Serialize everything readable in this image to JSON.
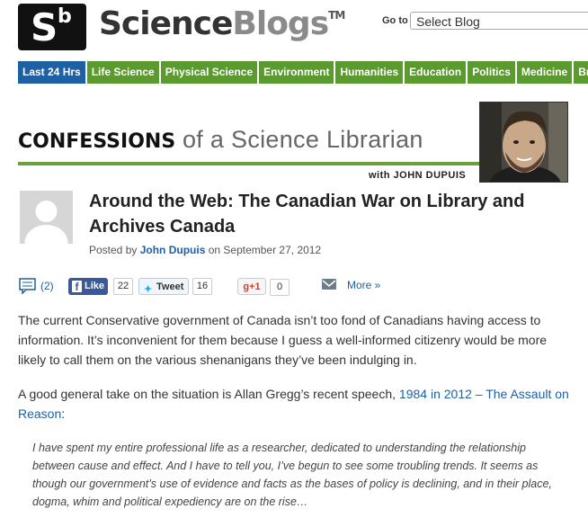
{
  "header": {
    "logo_letter": "S",
    "logo_superscript": "b",
    "brand_part1": "Science",
    "brand_part2": "Blogs",
    "brand_tm": "TM",
    "goto_label": "Go to",
    "goto_select_value": "Select Blog"
  },
  "nav": {
    "items": [
      {
        "label": "Last 24 Hrs",
        "active": true
      },
      {
        "label": "Life Science"
      },
      {
        "label": "Physical Science"
      },
      {
        "label": "Environment"
      },
      {
        "label": "Humanities"
      },
      {
        "label": "Education"
      },
      {
        "label": "Politics"
      },
      {
        "label": "Medicine"
      },
      {
        "label": "Bra"
      }
    ]
  },
  "blog": {
    "title_bold": "CONFESSIONS",
    "title_rest": " of a Science Librarian",
    "author_line": "with JOHN DUPUIS"
  },
  "post": {
    "title": "Around the Web: The Canadian War on Library and Archives Canada",
    "posted_by_label": "Posted by ",
    "author": "John Dupuis",
    "date_text": " on September 27, 2012"
  },
  "share": {
    "comments_count": "(2)",
    "fb_label": "Like",
    "fb_count": "22",
    "tweet_label": "Tweet",
    "tweet_count": "16",
    "gplus_label": "g+1",
    "gplus_count": "0",
    "more_label": "More »"
  },
  "body": {
    "para1": "The current Conservative government of Canada isn’t too fond of Canadians having access to information. It’s inconvenient for them because I guess a well-informed citizenry would be more likely to call them on the various shenanigans they’ve been indulging in.",
    "para2_text": "A good general take on the situation is Allan Gregg’s recent speech, ",
    "para2_link": "1984 in 2012 – The Assault on Reason",
    "para2_end": ":",
    "quote": "I have spent my entire professional life as a researcher, dedicated to understanding the relationship between cause and effect. And I have to tell you, I’ve begun to see some troubling trends. It seems as though our government’s use of evidence and facts as the bases of policy is declining, and in their place, dogma, whim and political expediency are on the rise…"
  },
  "colors": {
    "nav_green": "#5b9a2e",
    "nav_active_blue": "#1f5fa3",
    "link_blue": "#1f5fa3"
  }
}
